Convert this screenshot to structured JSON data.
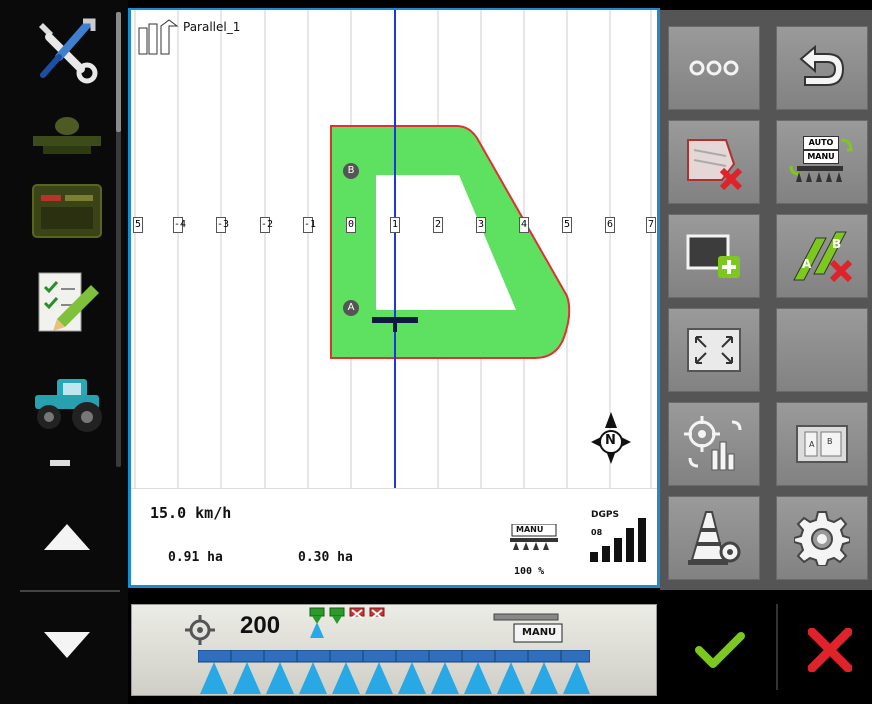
{
  "map": {
    "job_name": "Parallel_1",
    "track_labels": [
      "5",
      "-4",
      "-3",
      "-2",
      "-1",
      "0",
      "1",
      "2",
      "3",
      "4",
      "5",
      "6",
      "7"
    ],
    "point_a": "A",
    "point_b": "B",
    "compass_label": "N"
  },
  "info": {
    "speed": "15.0 km/h",
    "area_total": "0.91 ha",
    "area_partial": "0.30 ha",
    "mode_label": "MANU",
    "rate_percent": "100 %",
    "gps_label": "DGPS",
    "sat_count": "08"
  },
  "grid": {
    "auto_label": "AUTO",
    "manu_label": "MANU"
  },
  "bottom": {
    "rate_value": "200",
    "boom_mode": "MANU"
  },
  "colors": {
    "frame_blue": "#1d8bd0",
    "field_green": "#5ee060",
    "confirm_green": "#7cc81e",
    "cancel_red": "#e0232a",
    "nozzle_blue": "#29a8e6"
  }
}
